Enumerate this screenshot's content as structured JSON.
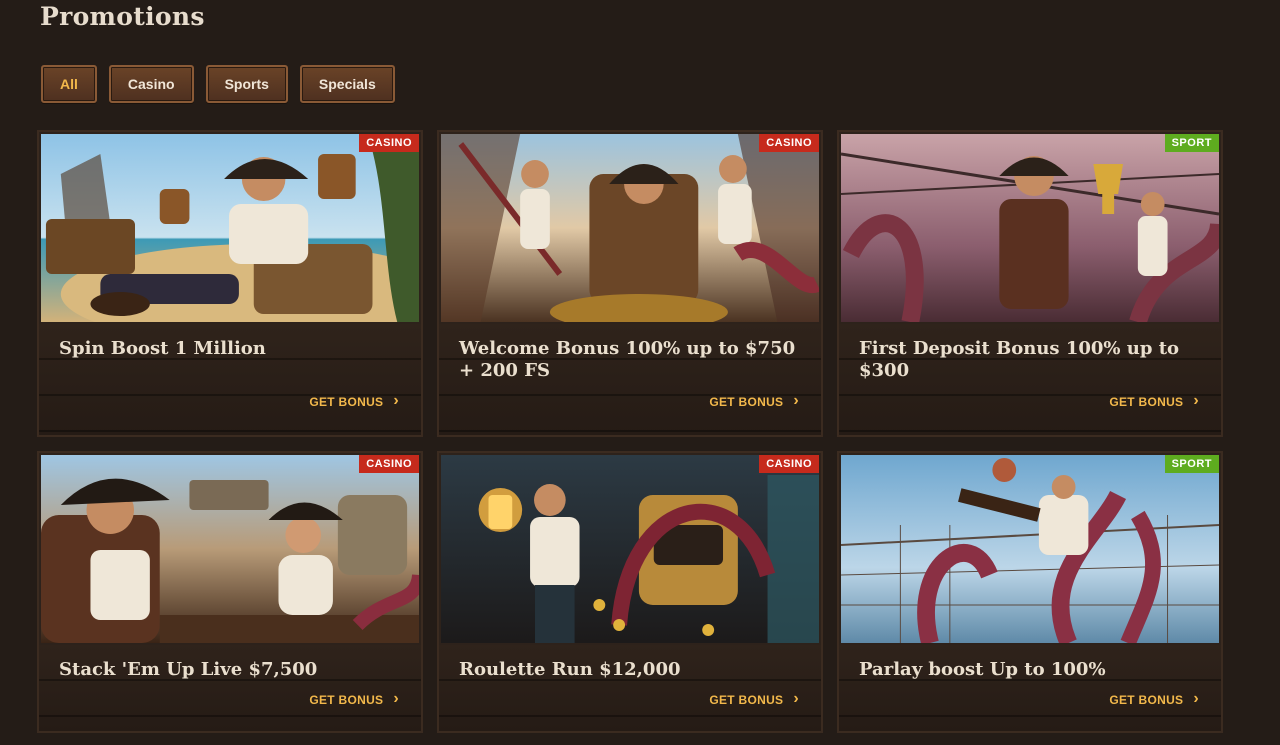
{
  "page": {
    "title": "Promotions"
  },
  "filters": [
    {
      "label": "All",
      "active": true
    },
    {
      "label": "Casino"
    },
    {
      "label": "Sports"
    },
    {
      "label": "Specials"
    }
  ],
  "colors": {
    "casino_badge": "#c62a1c",
    "sport_badge": "#5eac1f",
    "accent": "#f2b84b"
  },
  "promos": [
    {
      "title": "Spin Boost 1 Million",
      "badge": "CASINO",
      "cta": "GET BONUS",
      "art": "pirate-captain-beach-treasure-image"
    },
    {
      "title": "Welcome Bonus 100% up to $750 + 200 FS",
      "badge": "CASINO",
      "cta": "GET BONUS",
      "art": "pirate-crew-ship-deck-image"
    },
    {
      "title": "First Deposit Bonus 100% up to $300",
      "badge": "SPORT",
      "cta": "GET BONUS",
      "art": "pirate-trophy-kraken-image"
    },
    {
      "title": "Stack 'Em Up Live $7,500",
      "badge": "CASINO",
      "cta": "GET BONUS",
      "art": "pirate-couple-gold-coins-image"
    },
    {
      "title": "Roulette Run $12,000",
      "badge": "CASINO",
      "cta": "GET BONUS",
      "art": "pirate-lantern-slot-machine-image"
    },
    {
      "title": "Parlay boost Up to 100%",
      "badge": "SPORT",
      "cta": "GET BONUS",
      "art": "pirate-kraken-football-image"
    }
  ]
}
